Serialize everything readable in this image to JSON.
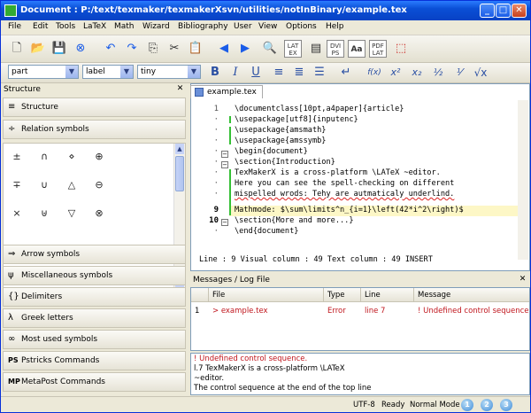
{
  "window": {
    "title": "Document : P:/text/texmaker/texmakerXsvn/utilities/notInBinary/example.tex"
  },
  "menu": [
    "File",
    "Edit",
    "Tools",
    "LaTeX",
    "Math",
    "Wizard",
    "Bibliography",
    "User",
    "View",
    "Options",
    "Help"
  ],
  "toolbar": {
    "dvi_ps": "DVI PS",
    "pdf_lat": "PDF LAT",
    "latex": "LAT EX",
    "aa": "Aa"
  },
  "format_bar": {
    "combo1": "part",
    "combo2": "label",
    "combo3": "tiny",
    "bold": "B",
    "italic": "I",
    "underline": "U",
    "fx": "f(x)"
  },
  "structure": {
    "title": "Structure",
    "categories": [
      "Structure",
      "Relation symbols",
      "Arrow symbols",
      "Miscellaneous symbols",
      "Delimiters",
      "Greek letters",
      "Most used symbols",
      "Pstricks Commands",
      "MetaPost Commands"
    ],
    "icons": [
      "≡",
      "÷",
      "⇒",
      "ψ",
      "{}",
      "λ",
      "∞",
      "PS",
      "MP"
    ],
    "symbols": [
      "±",
      "∩",
      "⋄",
      "⊕",
      "∓",
      "∪",
      "△",
      "⊖",
      "×",
      "⊎",
      "▽",
      "⊗"
    ]
  },
  "editor": {
    "tab": "example.tex",
    "line_numbers": [
      "1",
      "·",
      "·",
      "·",
      "·",
      "·",
      "·",
      "·",
      "·",
      "9",
      "10",
      "·"
    ],
    "lines": [
      "\\documentclass[10pt,a4paper]{article}",
      "\\usepackage[utf8]{inputenc}",
      "\\usepackage{amsmath}",
      "\\usepackage{amssymb}",
      "\\begin{document}",
      "\\section{Introduction}",
      "TexMakerX is a cross-platform \\LATeX ~editor.",
      "Here you can see the spell-checking on different",
      "mispelled wrods: Tehy are autmaticaly underlind.",
      "Mathmode: $\\sum\\limits^n_{i=1}\\left(42*i^2\\right)$",
      "\\section{More and more...}",
      "\\end{document}"
    ],
    "status": "Line : 9 Visual column : 49 Text column : 49  INSERT"
  },
  "messages": {
    "title": "Messages / Log File",
    "columns": [
      "",
      "File",
      "Type",
      "Line",
      "Message"
    ],
    "row": [
      "1",
      "> example.tex",
      "Error",
      "line 7",
      "! Undefined control sequence. Te"
    ],
    "log": [
      "! Undefined control sequence.",
      "l.7 TexMakerX is a cross-platform \\LATeX",
      "~editor.",
      "The control sequence at the end of the top line"
    ]
  },
  "statusbar": {
    "encoding": "UTF-8",
    "state": "Ready",
    "mode": "Normal Mode",
    "buttons": [
      "1",
      "2",
      "3"
    ]
  }
}
